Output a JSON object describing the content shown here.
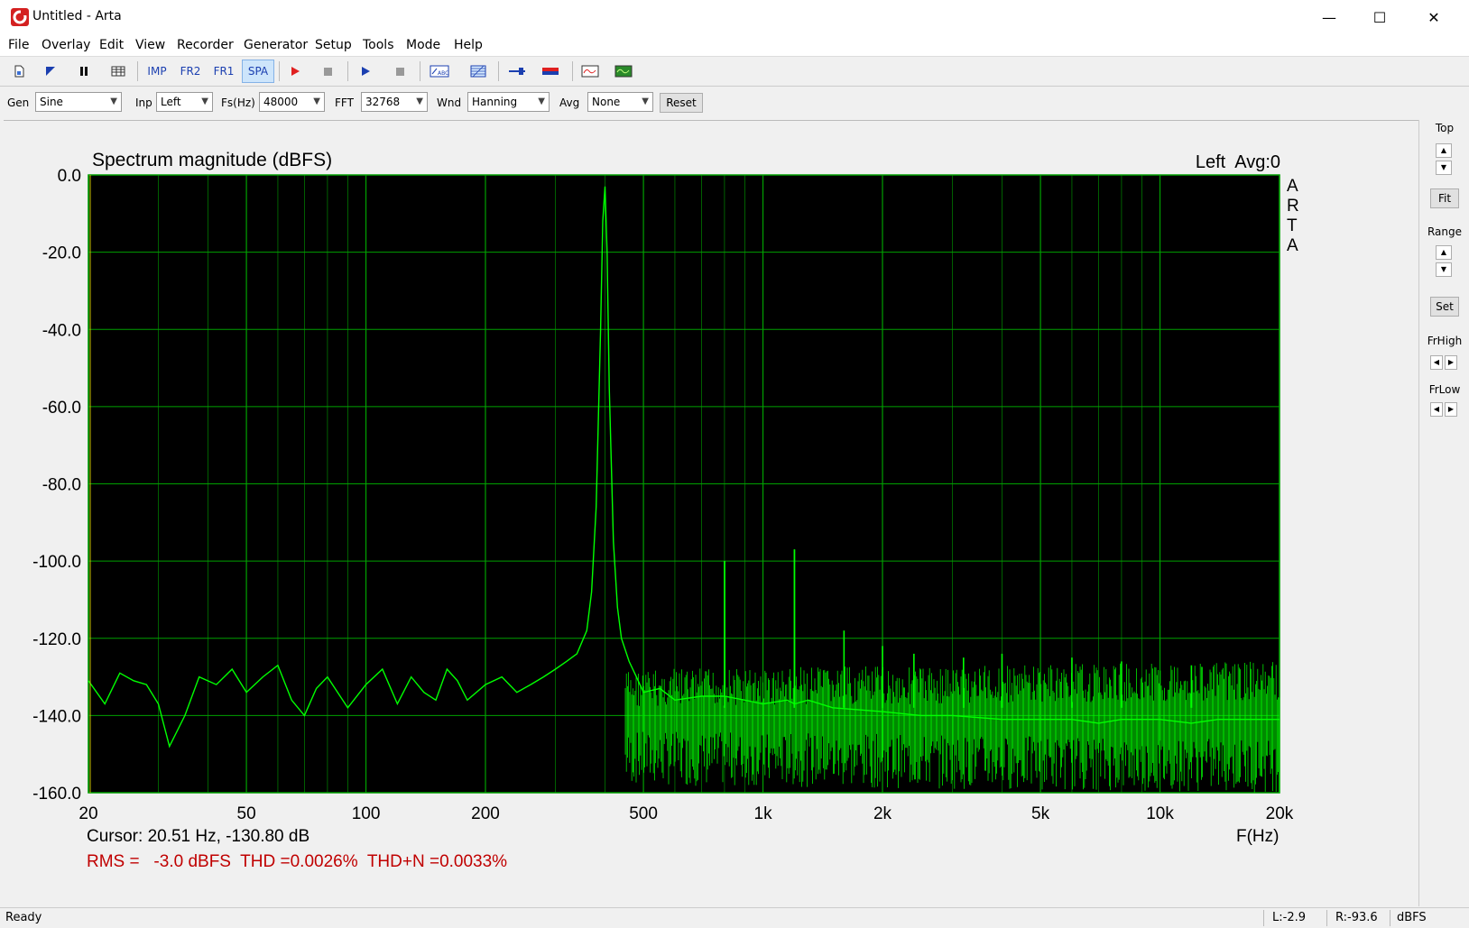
{
  "window": {
    "title": "Untitled - Arta"
  },
  "window_controls": {
    "minimize": "—",
    "maximize": "☐",
    "close": "✕"
  },
  "menu": [
    "File",
    "Overlay",
    "Edit",
    "View",
    "Recorder",
    "Generator",
    "Setup",
    "Tools",
    "Mode",
    "Help"
  ],
  "toolbar": {
    "imp": "IMP",
    "fr2": "FR2",
    "fr1": "FR1",
    "spa": "SPA",
    "icons": [
      "new-file-icon",
      "open-icon",
      "pause-icon",
      "table-icon",
      "record-red-icon",
      "stop-icon",
      "play-blue-icon",
      "stop-2-icon",
      "abc-icon",
      "grid-icon",
      "slider-icon",
      "colorbar-icon",
      "oscilloscope-icon",
      "green-scope-icon"
    ]
  },
  "controls": {
    "gen_label": "Gen",
    "gen_value": "Sine",
    "inp_label": "Inp",
    "inp_value": "Left",
    "fs_label": "Fs(Hz)",
    "fs_value": "48000",
    "fft_label": "FFT",
    "fft_value": "32768",
    "wnd_label": "Wnd",
    "wnd_value": "Hanning",
    "avg_label": "Avg",
    "avg_value": "None",
    "reset": "Reset"
  },
  "plot": {
    "title": "Spectrum magnitude (dBFS)",
    "channel_info": "Left  Avg:0",
    "watermark": [
      "A",
      "R",
      "T",
      "A"
    ],
    "xlabel": "F(Hz)",
    "cursor": "Cursor: 20.51 Hz, -130.80 dB",
    "measurements": "RMS =   -3.0 dBFS  THD =0.0026%  THD+N =0.0033%",
    "colors": {
      "background": "#000000",
      "grid": "#00a000",
      "trace": "#00ff00",
      "measurement_text": "#c00000"
    }
  },
  "chart_data": {
    "type": "line",
    "title": "Spectrum magnitude (dBFS)",
    "xlabel": "F(Hz)",
    "ylabel": "",
    "xscale": "log",
    "xlim": [
      20,
      20000
    ],
    "ylim": [
      -160,
      0
    ],
    "grid": true,
    "x_tick_values": [
      20,
      50,
      100,
      200,
      500,
      1000,
      2000,
      5000,
      10000,
      20000
    ],
    "x_tick_labels": [
      "20",
      "50",
      "100",
      "200",
      "500",
      "1k",
      "2k",
      "5k",
      "10k",
      "20k"
    ],
    "y_tick_values": [
      0,
      -20,
      -40,
      -60,
      -80,
      -100,
      -120,
      -140,
      -160
    ],
    "y_tick_labels": [
      "0.0",
      "-20.0",
      "-40.0",
      "-60.0",
      "-80.0",
      "-100.0",
      "-120.0",
      "-140.0",
      "-160.0"
    ],
    "series": [
      {
        "name": "",
        "x": [
          20,
          22,
          24,
          26,
          28,
          30,
          32,
          35,
          38,
          42,
          46,
          50,
          55,
          60,
          65,
          70,
          75,
          80,
          90,
          100,
          110,
          120,
          130,
          140,
          150,
          160,
          170,
          180,
          200,
          220,
          240,
          260,
          280,
          300,
          320,
          340,
          360,
          370,
          380,
          390,
          395,
          400,
          405,
          410,
          420,
          430,
          440,
          460,
          480,
          500,
          550,
          600,
          700,
          800,
          801,
          802,
          900,
          1000,
          1150,
          1200,
          1201,
          1202,
          1300,
          1500,
          2000,
          2500,
          3000,
          4000,
          5000,
          6000,
          7000,
          8000,
          10000,
          12000,
          14000,
          16000,
          18000,
          20000
        ],
        "y": [
          -131,
          -137,
          -129,
          -131,
          -132,
          -137,
          -148,
          -140,
          -130,
          -132,
          -128,
          -134,
          -130,
          -127,
          -136,
          -140,
          -133,
          -130,
          -138,
          -132,
          -128,
          -137,
          -130,
          -134,
          -136,
          -128,
          -131,
          -136,
          -132,
          -130,
          -134,
          -132,
          -130,
          -128,
          -126,
          -124,
          -118,
          -108,
          -86,
          -40,
          -12,
          -3,
          -20,
          -55,
          -95,
          -112,
          -120,
          -126,
          -130,
          -134,
          -133,
          -136,
          -135,
          -135,
          -100,
          -135,
          -136,
          -137,
          -136,
          -137,
          -97,
          -137,
          -136,
          -138,
          -139,
          -140,
          -140,
          -141,
          -141,
          -141,
          -142,
          -141,
          -141,
          -142,
          -141,
          -141,
          -141,
          -141
        ]
      }
    ],
    "harmonics": [
      {
        "x": 800,
        "y": -100
      },
      {
        "x": 1200,
        "y": -97
      },
      {
        "x": 1600,
        "y": -118
      },
      {
        "x": 2000,
        "y": -122
      },
      {
        "x": 2400,
        "y": -124
      },
      {
        "x": 3200,
        "y": -125
      },
      {
        "x": 4000,
        "y": -124
      },
      {
        "x": 6000,
        "y": -125
      },
      {
        "x": 8000,
        "y": -126
      },
      {
        "x": 12000,
        "y": -127
      }
    ],
    "noise_floor": [
      {
        "x_from": 450,
        "x_to": 20000,
        "y_low": -158,
        "y_high": -126
      }
    ]
  },
  "right_panel": {
    "top": "Top",
    "fit": "Fit",
    "range": "Range",
    "set": "Set",
    "frhigh": "FrHigh",
    "frlow": "FrLow"
  },
  "status": {
    "ready": "Ready",
    "left_level": "L:-2.9",
    "right_level": "R:-93.6",
    "unit": "dBFS"
  }
}
